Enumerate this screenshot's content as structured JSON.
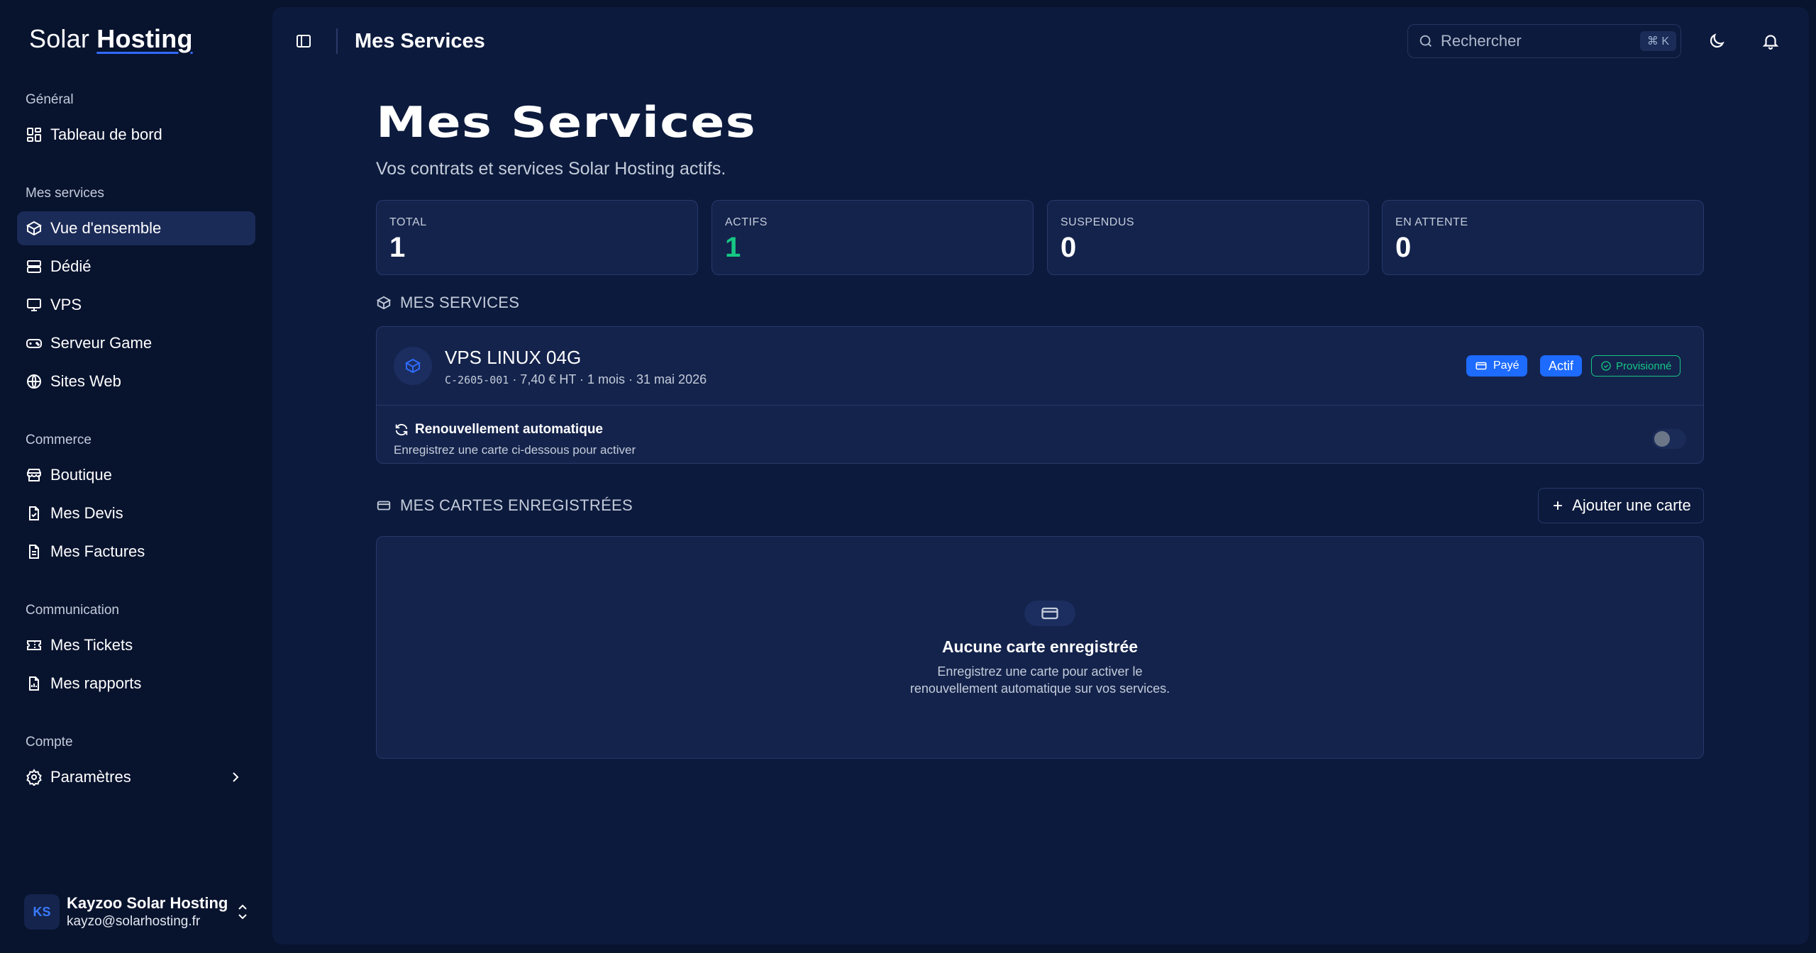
{
  "brand": {
    "name_light": "Solar",
    "name_bold": "Hosting"
  },
  "nav": {
    "groups": [
      {
        "title": "Général",
        "items": [
          {
            "label": "Tableau de bord",
            "icon": "dashboard-icon"
          }
        ]
      },
      {
        "title": "Mes services",
        "items": [
          {
            "label": "Vue d'ensemble",
            "icon": "box-icon",
            "active": true
          },
          {
            "label": "Dédié",
            "icon": "server-icon"
          },
          {
            "label": "VPS",
            "icon": "monitor-icon"
          },
          {
            "label": "Serveur Game",
            "icon": "gamepad-icon"
          },
          {
            "label": "Sites Web",
            "icon": "globe-icon"
          }
        ]
      },
      {
        "title": "Commerce",
        "items": [
          {
            "label": "Boutique",
            "icon": "store-icon"
          },
          {
            "label": "Mes Devis",
            "icon": "file-check-icon"
          },
          {
            "label": "Mes Factures",
            "icon": "file-text-icon"
          }
        ]
      },
      {
        "title": "Communication",
        "items": [
          {
            "label": "Mes Tickets",
            "icon": "ticket-icon"
          },
          {
            "label": "Mes rapports",
            "icon": "file-chart-icon"
          }
        ]
      },
      {
        "title": "Compte",
        "items": [
          {
            "label": "Paramètres",
            "icon": "gear-icon"
          }
        ]
      }
    ]
  },
  "user": {
    "initials": "KS",
    "name": "Kayzoo Solar Hosting",
    "email": "kayzo@solarhosting.fr"
  },
  "topbar": {
    "title": "Mes Services",
    "search_placeholder": "Rechercher",
    "shortcut": "⌘ K"
  },
  "page": {
    "title": "Mes Services",
    "subtitle": "Vos contrats et services Solar Hosting actifs."
  },
  "stats": [
    {
      "label": "TOTAL",
      "value": "1"
    },
    {
      "label": "ACTIFS",
      "value": "1"
    },
    {
      "label": "SUSPENDUS",
      "value": "0"
    },
    {
      "label": "EN ATTENTE",
      "value": "0"
    }
  ],
  "services_section": {
    "title": "MES SERVICES"
  },
  "service": {
    "name": "VPS LINUX 04G",
    "code": "C-2605-001",
    "meta": " · 7,40 € HT · 1 mois · 31 mai 2026",
    "badge_paid": "Payé",
    "badge_active": "Actif",
    "badge_provisioned": "Provisionné",
    "renew_title": "Renouvellement automatique",
    "renew_sub": "Enregistrez une carte ci-dessous pour activer",
    "auto_renew_enabled": false
  },
  "cards_section": {
    "title": "MES CARTES ENREGISTRÉES",
    "add_label": "Ajouter une carte"
  },
  "empty_cards": {
    "title": "Aucune carte enregistrée",
    "line1": "Enregistrez une carte pour activer le",
    "line2": "renouvellement automatique sur vos services."
  },
  "colors": {
    "accent": "#1d6bff",
    "success": "#16c784",
    "background": "#08132e",
    "panel": "#0c1a3d",
    "card": "#14234c"
  }
}
